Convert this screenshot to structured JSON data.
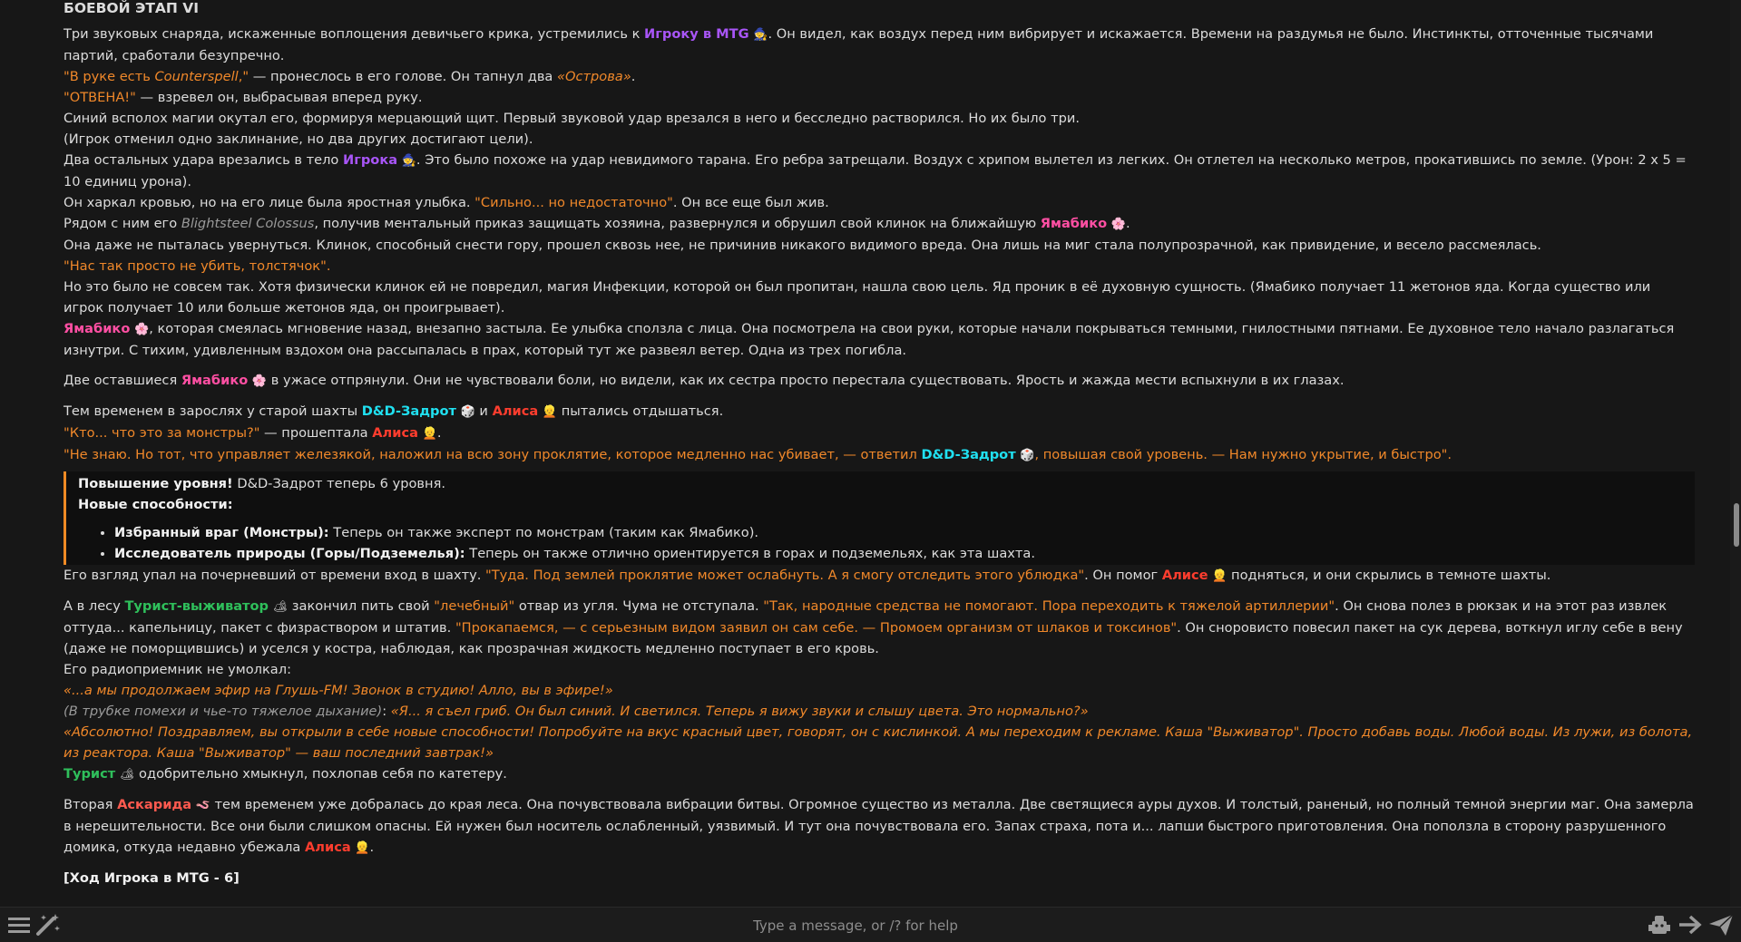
{
  "heading": "БОЕВОЙ ЭТАП VI",
  "p1": {
    "a": "Три звуковых снаряда, искаженные воплощения девичьего крика, устремились к ",
    "player": "Игроку в MTG",
    "b": ". Он видел, как воздух перед ним вибрирует и искажается. Времени на раздумья не было. Инстинкты, отточенные тысячами партий, сработали безупречно."
  },
  "l2": {
    "q1": "\"В руке есть ",
    "card": "Counterspell",
    "q2": ",\"",
    "b": " — пронеслось в его голове. Он тапнул два ",
    "island": "«Острова»",
    "c": "."
  },
  "l3": {
    "q": "\"ОТВЕНА!\"",
    "b": " — взревел он, выбрасывая вперед руку."
  },
  "l4": "Синий всполох магии окутал его, формируя мерцающий щит. Первый звуковой удар врезался в него и бесследно растворился. Но их было три.",
  "l5": "(Игрок отменил одно заклинание, но два других достигают цели).",
  "l6": {
    "a": "Два остальных удара врезались в тело ",
    "player": "Игрока",
    "b": ". Это было похоже на удар невидимого тарана. Его ребра затрещали. Воздух с хрипом вылетел из легких. Он отлетел на несколько метров, прокатившись по земле. (Урон: 2 x 5 = 10 единиц урона)."
  },
  "l7": {
    "a": "Он харкал кровью, но на его лице была яростная улыбка. ",
    "q": "\"Сильно... но недостаточно\"",
    "b": ". Он все еще был жив."
  },
  "l8": {
    "a": "Рядом с ним его ",
    "colossus": "Blightsteel Colossus",
    "b": ", получив ментальный приказ защищать хозяина, развернулся и обрушил свой клинок на ближайшую ",
    "yamabiko": "Ямабико",
    "c": "."
  },
  "l9": "Она даже не пыталась увернуться. Клинок, способный снести гору, прошел сквозь нее, не причинив никакого видимого вреда. Она лишь на миг стала полупрозрачной, как привидение, и весело рассмеялась.",
  "l10": "\"Нас так просто не убить, толстячок\".",
  "l11": "Но это было не совсем так. Хотя физически клинок ей не повредил, магия Инфекции, которой он был пропитан, нашла свою цель. Яд проник в её духовную сущность. (Ямабико получает 11 жетонов яда. Когда существо или игрок получает 10 или больше жетонов яда, он проигрывает).",
  "l12": {
    "yamabiko": "Ямабико",
    "b": ", которая смеялась мгновение назад, внезапно застыла. Ее улыбка сползла с лица. Она посмотрела на свои руки, которые начали покрываться темными, гнилостными пятнами. Ее духовное тело начало разлагаться изнутри. С тихим, удивленным вздохом она рассыпалась в прах, который тут же развеял ветер. Одна из трех погибла."
  },
  "l13": {
    "a": "Две оставшиеся ",
    "yamabiko": "Ямабико",
    "b": " в ужасе отпрянули. Они не чувствовали боли, но видели, как их сестра просто перестала существовать. Ярость и жажда мести вспыхнули в их глазах."
  },
  "l14": {
    "a": "Тем временем в зарослях у старой шахты ",
    "dnd": "D&D-Задрот",
    "and": " и ",
    "alice": "Алиса",
    "b": " пытались отдышаться."
  },
  "l15": {
    "q": "\"Кто... что это за монстры?\"",
    "b": " — прошептала ",
    "alice": "Алиса",
    "c": "."
  },
  "l16": {
    "q1": "\"Не знаю. Но тот, что управляет железякой, наложил на всю зону проклятие, которое медленно нас убивает, — ответил ",
    "dnd": "D&D-Задрот",
    "q2": ", повышая свой уровень. — Нам нужно укрытие, и быстро\"."
  },
  "box": {
    "title": "Повышение уровня!",
    "title_rest": " D&D-Задрот теперь 6 уровня.",
    "abilities": "Новые способности:",
    "items": [
      {
        "bold": "Избранный враг (Монстры):",
        "rest": " Теперь он также эксперт по монстрам (таким как Ямабико)."
      },
      {
        "bold": "Исследователь природы (Горы/Подземелья):",
        "rest": " Теперь он также отлично ориентируется в горах и подземельях, как эта шахта."
      }
    ]
  },
  "l17": {
    "a": "Его взгляд упал на почерневший от времени вход в шахту. ",
    "q": "\"Туда. Под землей проклятие может ослабнуть. А я смогу отследить этого ублюдка\"",
    "b": ". Он помог ",
    "alice": "Алисе",
    "c": " подняться, и они скрылись в темноте шахты."
  },
  "l18": {
    "a": "А в лесу ",
    "tourist": "Турист-выживатор",
    "b": " закончил пить свой ",
    "q1": "\"лечебный\"",
    "c": " отвар из угля. Чума не отступала. ",
    "q2": "\"Так, народные средства не помогают. Пора переходить к тяжелой артиллерии\"",
    "d": ". Он снова полез в рюкзак и на этот раз извлек оттуда... капельницу, пакет с физраствором и штатив. ",
    "q3": "\"Прокапаемся, — с серьезным видом заявил он сам себе. — Промоем организм от шлаков и токсинов\"",
    "e": ". Он сноровисто повесил пакет на сук дерева, воткнул иглу себе в вену (даже не поморщившись) и уселся у костра, наблюдая, как прозрачная жидкость медленно поступает в его кровь."
  },
  "l19": "Его радиоприемник не умолкал:",
  "l20": "«...а мы продолжаем эфир на Глушь-FM! Звонок в студию! Алло, вы в эфире!»",
  "l21": {
    "g": "(В трубке помехи и чье-то тяжелое дыхание)",
    "colon": ": ",
    "q": "«Я... я съел гриб. Он был синий. И светился. Теперь я вижу звуки и слышу цвета. Это нормально?»"
  },
  "l22": "«Абсолютно! Поздравляем, вы открыли в себе новые способности! Попробуйте на вкус красный цвет, говорят, он с кислинкой. А мы переходим к рекламе. Каша \"Выживатор\". Просто добавь воды. Любой воды. Из лужи, из болота, из реактора. Каша \"Выживатор\" — ваш последний завтрак!»",
  "l23": {
    "tourist": "Турист",
    "b": " одобрительно хмыкнул, похлопав себя по катетеру."
  },
  "l24": {
    "a": "Вторая ",
    "ascarida": "Аскарида",
    "b": " тем временем уже добралась до края леса. Она почувствовала вибрации битвы. Огромное существо из металла. Две светящиеся ауры духов. И толстый, раненый, но полный темной энергии маг. Она замерла в нерешительности. Все они были слишком опасны. Ей нужен был носитель ослабленный, уязвимый. И тут она почувствовала его. Запах страха, пота и... лапши быстрого приготовления. Она поползла в сторону разрушенного домика, откуда недавно убежала ",
    "alice": "Алиса",
    "c": "."
  },
  "l25": "[Ход Игрока в MTG - 6]",
  "emoji": {
    "wizard": "🧙",
    "flower": "🌸",
    "die": "🎲",
    "girl": "👱",
    "camper": "🏕",
    "worm": "🪱"
  },
  "input": {
    "placeholder": "Type a message, or /? for help"
  },
  "colors": {
    "background": "#171717",
    "quote": "#f0882a",
    "box_border": "#f08a24"
  }
}
